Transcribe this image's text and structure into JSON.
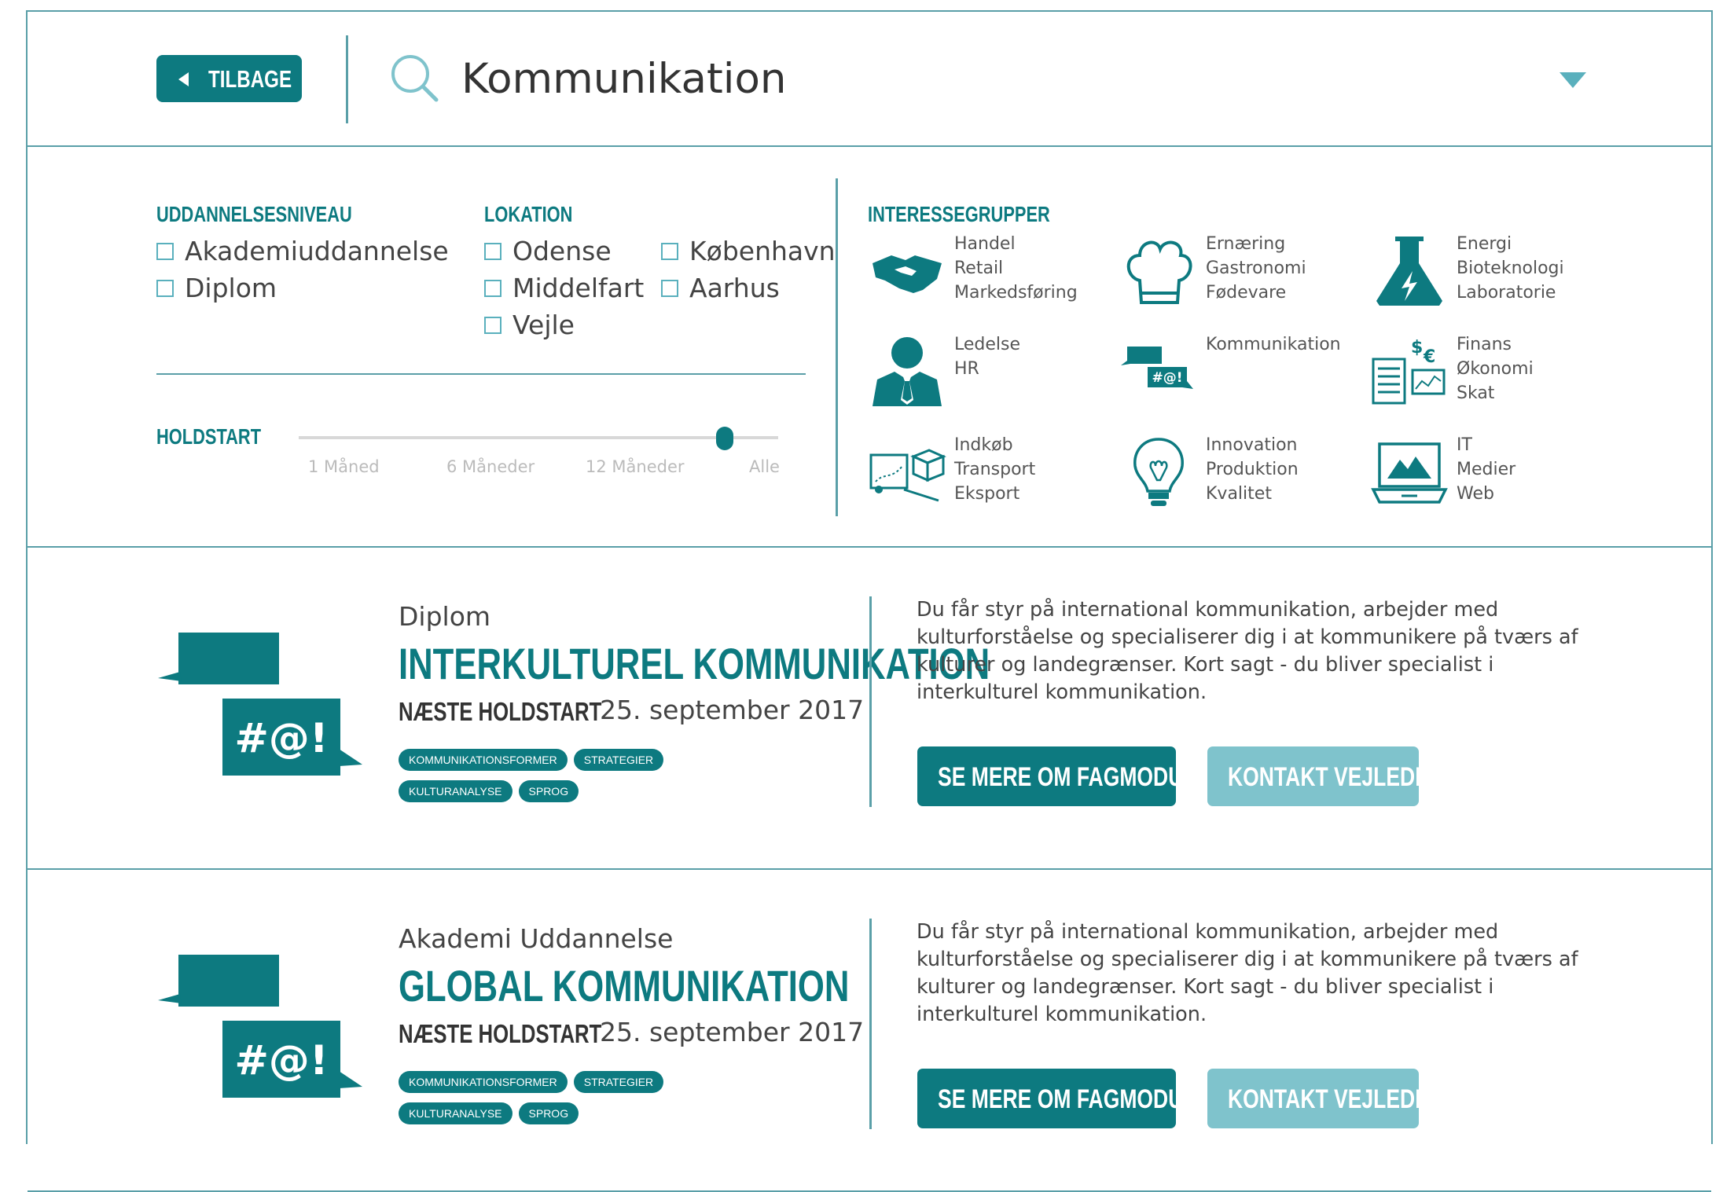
{
  "header": {
    "back_label": "TILBAGE",
    "search_value": "Kommunikation"
  },
  "filters": {
    "education_title": "UDDANNELSESNIVEAU",
    "education_options": [
      "Akademiuddannelse",
      "Diplom"
    ],
    "location_title": "LOKATION",
    "location_col1": [
      "Odense",
      "Middelfart",
      "Vejle"
    ],
    "location_col2": [
      "København",
      "Aarhus"
    ],
    "holdstart_title": "HOLDSTART",
    "holdstart_labels": [
      "1 Måned",
      "6 Måneder",
      "12 Måneder",
      "Alle"
    ],
    "holdstart_selected": "Alle",
    "interests_title": "INTERESSEGRUPPER",
    "interests": [
      {
        "icon": "handshake-icon",
        "lines": [
          "Handel",
          "Retail",
          "Markedsføring"
        ]
      },
      {
        "icon": "chef-hat-icon",
        "lines": [
          "Ernæring",
          "Gastronomi",
          "Fødevare"
        ]
      },
      {
        "icon": "flask-icon",
        "lines": [
          "Energi",
          "Bioteknologi",
          "Laboratorie"
        ]
      },
      {
        "icon": "manager-icon",
        "lines": [
          "Ledelse",
          "HR"
        ]
      },
      {
        "icon": "speech-bubbles-icon",
        "lines": [
          "Kommunikation"
        ]
      },
      {
        "icon": "finance-icon",
        "lines": [
          "Finans",
          "Økonomi",
          "Skat"
        ]
      },
      {
        "icon": "logistics-icon",
        "lines": [
          "Indkøb",
          "Transport",
          "Eksport"
        ]
      },
      {
        "icon": "lightbulb-icon",
        "lines": [
          "Innovation",
          "Produktion",
          "Kvalitet"
        ]
      },
      {
        "icon": "laptop-icon",
        "lines": [
          "IT",
          "Medier",
          "Web"
        ]
      }
    ]
  },
  "results": [
    {
      "icon": "speech-bubbles-icon",
      "level": "Diplom",
      "title": "INTERKULTUREL KOMMUNIKATION",
      "next_label": "NÆSTE HOLDSTART",
      "date": "25. september 2017",
      "tags": [
        "KOMMUNIKATIONSFORMER",
        "STRATEGIER",
        "KULTURANALYSE",
        "SPROG"
      ],
      "description": "Du får styr på international kommunikation, arbejder med kulturforståelse og specialiserer dig i at kommunikere på tværs af kulturer og landegrænser. Kort sagt - du bliver specialist i interkulturel kommunikation.",
      "primary_button": "SE MERE OM FAGMODULET",
      "secondary_button": "KONTAKT VEJLEDER"
    },
    {
      "icon": "speech-bubbles-icon",
      "level": "Akademi Uddannelse",
      "title": "GLOBAL KOMMUNIKATION",
      "next_label": "NÆSTE HOLDSTART",
      "date": "25. september 2017",
      "tags": [
        "KOMMUNIKATIONSFORMER",
        "STRATEGIER",
        "KULTURANALYSE",
        "SPROG"
      ],
      "description": "Du får styr på international kommunikation, arbejder med kulturforståelse og specialiserer dig i at kommunikere på tværs af kulturer og landegrænser. Kort sagt - du bliver specialist i interkulturel kommunikation.",
      "primary_button": "SE MERE OM FAGMODULET",
      "secondary_button": "KONTAKT VEJLEDER"
    }
  ],
  "colors": {
    "accent": "#0d7a80",
    "accent_light": "#7fc3cc",
    "rule": "#5a9fa8"
  }
}
